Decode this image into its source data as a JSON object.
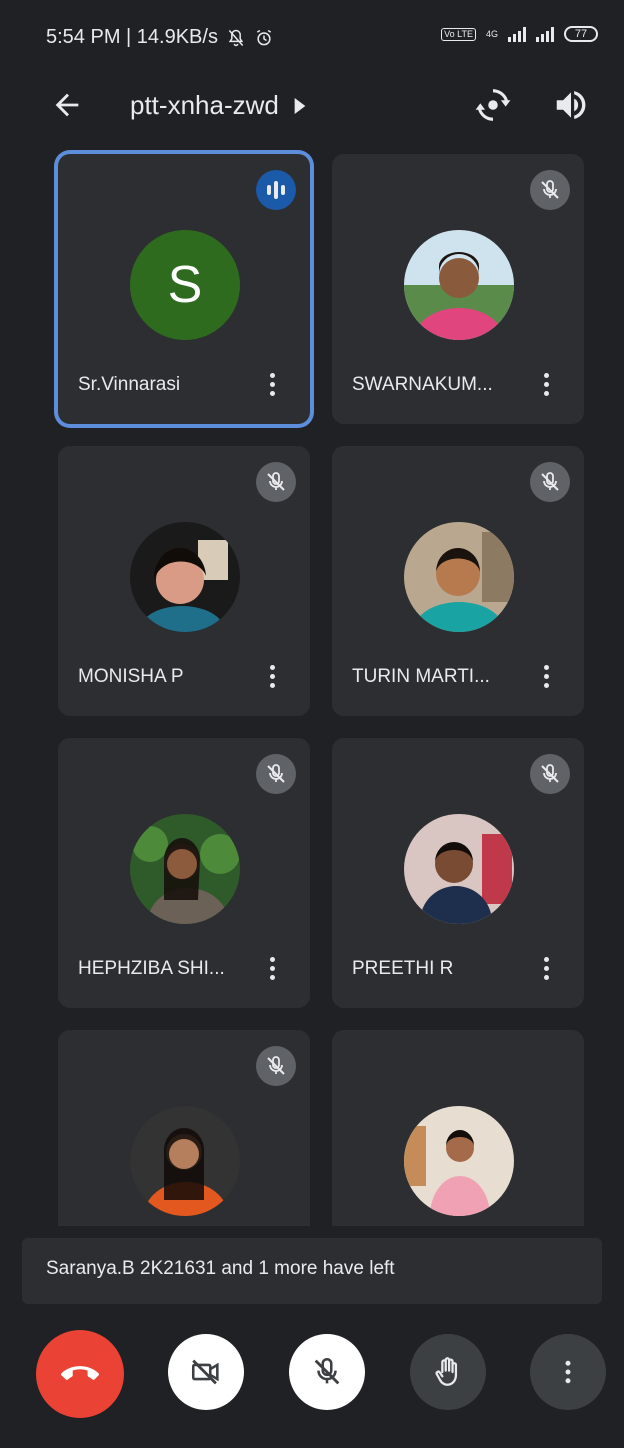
{
  "status_bar": {
    "time_text": "5:54 PM | 14.9KB/s",
    "volte_label": "Vo LTE",
    "network_label": "4G",
    "battery_level": "77"
  },
  "header": {
    "meeting_code": "ptt-xnha-zwd"
  },
  "participants": [
    {
      "name": "Sr.Vinnarasi",
      "avatar_letter": "S",
      "state": "speaking"
    },
    {
      "name": "SWARNAKUM...",
      "state": "muted"
    },
    {
      "name": "MONISHA P",
      "state": "muted"
    },
    {
      "name": "TURIN MARTI...",
      "state": "muted"
    },
    {
      "name": "HEPHZIBA SHI...",
      "state": "muted"
    },
    {
      "name": "PREETHI R",
      "state": "muted"
    },
    {
      "name": "",
      "state": "muted"
    },
    {
      "name": "",
      "state": "unknown"
    }
  ],
  "notification": {
    "text": "Saranya.B 2K21631 and 1 more have left"
  },
  "colors": {
    "background": "#202124",
    "tile": "#2d2e31",
    "active_border": "#5d8edb",
    "end_call": "#ea4335",
    "speaking_badge": "#1a5aa8",
    "avatar_green": "#2e6b1f"
  }
}
